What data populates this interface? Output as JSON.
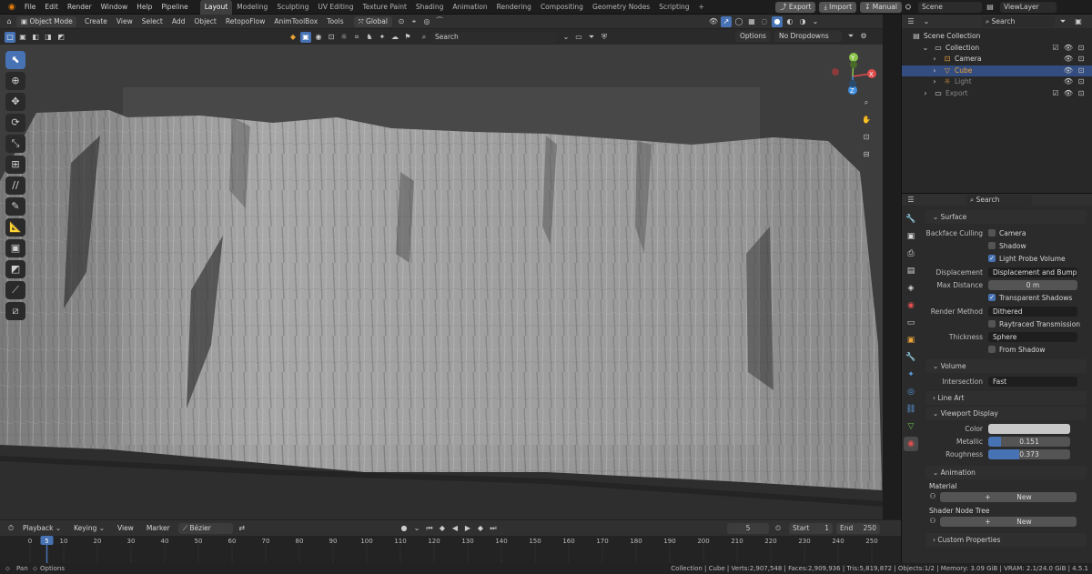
{
  "topbar": {
    "menus": [
      "File",
      "Edit",
      "Render",
      "Window",
      "Help",
      "Pipeline"
    ],
    "workspaces": [
      "Layout",
      "Modeling",
      "Sculpting",
      "UV Editing",
      "Texture Paint",
      "Shading",
      "Animation",
      "Rendering",
      "Compositing",
      "Geometry Nodes",
      "Scripting"
    ],
    "active_workspace": "Layout",
    "add_tab": "+",
    "export_label": "Export",
    "import_label": "Import",
    "manual_label": "Manual",
    "scene_name": "Scene",
    "viewlayer_name": "ViewLayer"
  },
  "viewport_header": {
    "mode": "Object Mode",
    "menus": [
      "Create",
      "View",
      "Select",
      "Add",
      "Object",
      "RetopoFlow",
      "AnimToolBox",
      "Tools"
    ],
    "orientation": "Global",
    "search_placeholder": "Search",
    "options_label": "Options",
    "dropdowns_label": "No Dropdowns"
  },
  "nav_gizmo": {
    "x": "X",
    "y": "Y",
    "z": "Z"
  },
  "outliner": {
    "search_placeholder": "Search",
    "scene_collection": "Scene Collection",
    "items": [
      {
        "label": "Collection",
        "icon": "collection-icon",
        "indent": 1
      },
      {
        "label": "Camera",
        "icon": "camera-icon",
        "indent": 2
      },
      {
        "label": "Cube",
        "icon": "mesh-icon",
        "indent": 2,
        "selected": true
      },
      {
        "label": "Light",
        "icon": "light-icon",
        "indent": 2
      },
      {
        "label": "Export",
        "icon": "collection-icon",
        "indent": 1
      }
    ]
  },
  "properties": {
    "search_placeholder": "Search",
    "surface": {
      "header": "Surface",
      "backface_culling_label": "Backface Culling",
      "camera_label": "Camera",
      "shadow_label": "Shadow",
      "light_probe_label": "Light Probe Volume",
      "displacement_label": "Displacement",
      "displacement_value": "Displacement and Bump",
      "max_distance_label": "Max Distance",
      "max_distance_value": "0 m",
      "transparent_shadows_label": "Transparent Shadows",
      "render_method_label": "Render Method",
      "render_method_value": "Dithered",
      "raytraced_label": "Raytraced Transmission",
      "thickness_label": "Thickness",
      "thickness_value": "Sphere",
      "from_shadow_label": "From Shadow"
    },
    "volume": {
      "header": "Volume",
      "intersection_label": "Intersection",
      "intersection_value": "Fast"
    },
    "line_art": {
      "header": "Line Art"
    },
    "viewport_display": {
      "header": "Viewport Display",
      "color_label": "Color",
      "color_value": "#c8c8c8",
      "metallic_label": "Metallic",
      "metallic_value": "0.151",
      "metallic_fraction": 0.151,
      "roughness_label": "Roughness",
      "roughness_value": "0.373",
      "roughness_fraction": 0.373
    },
    "animation": {
      "header": "Animation",
      "material_label": "Material",
      "new_label": "New",
      "shader_tree_label": "Shader Node Tree",
      "new_label2": "New"
    },
    "custom_props": {
      "header": "Custom Properties"
    }
  },
  "timeline": {
    "playback_label": "Playback",
    "keying_label": "Keying",
    "view_label": "View",
    "marker_label": "Marker",
    "interp_label": "Bézier",
    "current_frame": "5",
    "start_label": "Start",
    "start_value": "1",
    "end_label": "End",
    "end_value": "250",
    "ticks": [
      "0",
      "5",
      "10",
      "20",
      "30",
      "40",
      "50",
      "60",
      "70",
      "80",
      "90",
      "100",
      "110",
      "120",
      "130",
      "140",
      "150",
      "160",
      "170",
      "180",
      "190",
      "200",
      "210",
      "220",
      "230",
      "240",
      "250"
    ]
  },
  "statusbar": {
    "pan_label": "Pan",
    "options_label": "Options",
    "info": "Collection | Cube | Verts:2,907,548 | Faces:2,909,936 | Tris:5,819,872 | Objects:1/2 | Memory: 3.09 GiB | VRAM: 2.1/24.0 GiB | 4.5.1"
  },
  "colors": {
    "accent": "#4772b3",
    "selection": "#334d80",
    "x_axis": "#e04c4c",
    "y_axis": "#8bc34a",
    "z_axis": "#3f8fe0"
  }
}
